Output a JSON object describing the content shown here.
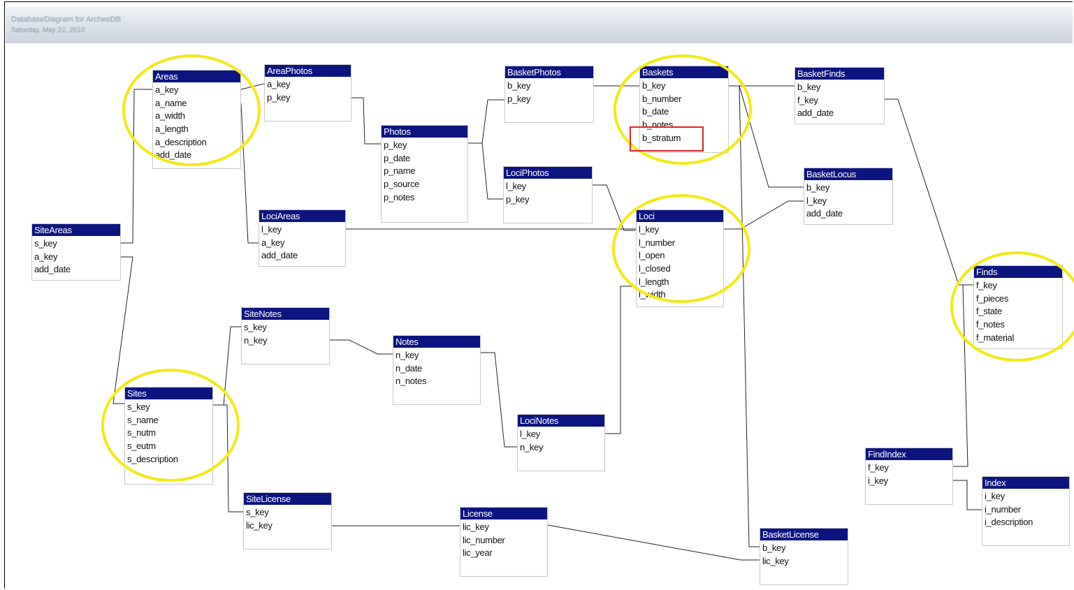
{
  "header": {
    "line1": "DatabaseDiagram for ArcheoDB",
    "line2": "Saturday, May 22, 2010"
  },
  "tables": [
    {
      "name": "SiteAreas",
      "fields": [
        "s_key",
        "a_key",
        "add_date"
      ]
    },
    {
      "name": "Areas",
      "fields": [
        "a_key",
        "a_name",
        "a_width",
        "a_length",
        "a_description",
        "add_date"
      ]
    },
    {
      "name": "AreaPhotos",
      "fields": [
        "a_key",
        "p_key"
      ]
    },
    {
      "name": "Photos",
      "fields": [
        "p_key",
        "p_date",
        "p_name",
        "p_source",
        "p_notes"
      ]
    },
    {
      "name": "BasketPhotos",
      "fields": [
        "b_key",
        "p_key"
      ]
    },
    {
      "name": "Baskets",
      "fields": [
        "b_key",
        "b_number",
        "b_date",
        "b_notes",
        "b_stratum"
      ]
    },
    {
      "name": "BasketFinds",
      "fields": [
        "b_key",
        "f_key",
        "add_date"
      ]
    },
    {
      "name": "LociPhotos",
      "fields": [
        "l_key",
        "p_key"
      ]
    },
    {
      "name": "BasketLocus",
      "fields": [
        "b_key",
        "l_key",
        "add_date"
      ]
    },
    {
      "name": "LociAreas",
      "fields": [
        "l_key",
        "a_key",
        "add_date"
      ]
    },
    {
      "name": "Loci",
      "fields": [
        "l_key",
        "l_number",
        "l_open",
        "l_closed",
        "l_length",
        "l_width"
      ]
    },
    {
      "name": "Finds",
      "fields": [
        "f_key",
        "f_pieces",
        "f_state",
        "f_notes",
        "f_material"
      ]
    },
    {
      "name": "SiteNotes",
      "fields": [
        "s_key",
        "n_key"
      ]
    },
    {
      "name": "Notes",
      "fields": [
        "n_key",
        "n_date",
        "n_notes"
      ]
    },
    {
      "name": "Sites",
      "fields": [
        "s_key",
        "s_name",
        "s_nutm",
        "s_eutm",
        "s_description"
      ]
    },
    {
      "name": "LociNotes",
      "fields": [
        "l_key",
        "n_key"
      ]
    },
    {
      "name": "FindIndex",
      "fields": [
        "f_key",
        "i_key"
      ]
    },
    {
      "name": "Index",
      "fields": [
        "i_key",
        "i_number",
        "i_description"
      ]
    },
    {
      "name": "SiteLicense",
      "fields": [
        "s_key",
        "lic_key"
      ]
    },
    {
      "name": "License",
      "fields": [
        "lic_key",
        "lic_number",
        "lic_year"
      ]
    },
    {
      "name": "BasketLicense",
      "fields": [
        "b_key",
        "lic_key"
      ]
    }
  ],
  "highlight_colors": {
    "circle": "#f3ea15",
    "box": "#e0202a",
    "header": "#0c1480"
  }
}
